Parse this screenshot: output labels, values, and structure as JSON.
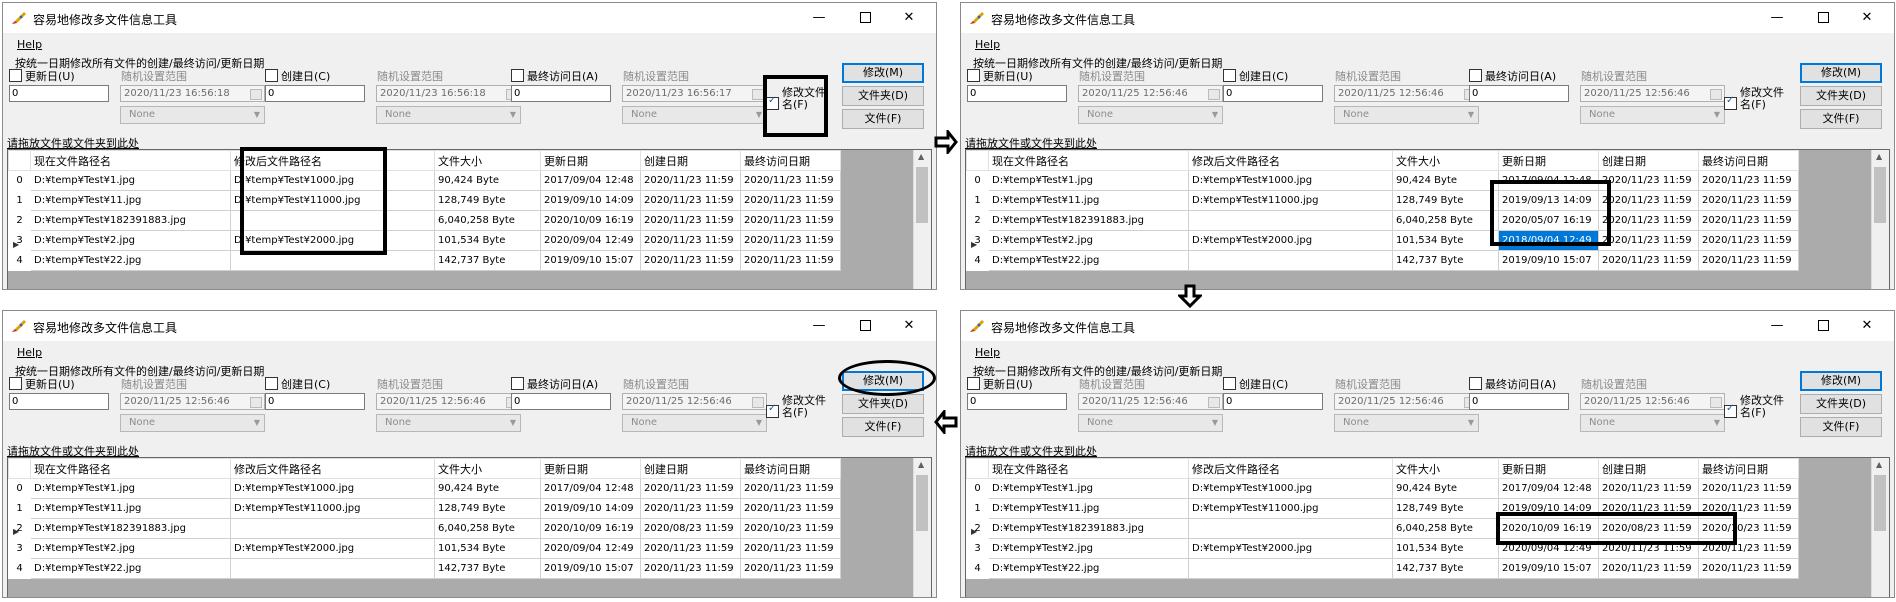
{
  "app": {
    "title": "容易地修改多文件信息工具",
    "menu_help": "Help",
    "instruction": "按统一日期修改所有文件的创建/最终访问/更新日期"
  },
  "controls": {
    "update_label": "更新日(U)",
    "create_label": "创建日(C)",
    "access_label": "最终访问日(A)",
    "random_label": "随机设置范围",
    "none_label": "None",
    "rename_label": "修改文件名(F)",
    "btn_modify": "修改(M)",
    "btn_folder": "文件夹(D)",
    "btn_file": "文件(F)",
    "drop_label": "请拖放文件或文件夹到此处"
  },
  "columns": [
    "现在文件路径名",
    "修改后文件路径名",
    "文件大小",
    "更新日期",
    "创建日期",
    "最终访问日期"
  ],
  "screens": [
    {
      "num_value": "0",
      "dates": [
        "2020/11/23 16:56:18",
        "2020/11/23 16:56:18",
        "2020/11/23 16:56:17"
      ],
      "rename_checked": true,
      "rows": [
        [
          "0",
          "D:¥temp¥Test¥1.jpg",
          "D:¥temp¥Test¥1000.jpg",
          "90,424 Byte",
          "2017/09/04 12:48",
          "2020/11/23 11:59",
          "2020/11/23 11:59"
        ],
        [
          "1",
          "D:¥temp¥Test¥11.jpg",
          "D:¥temp¥Test¥11000.jpg",
          "128,749 Byte",
          "2019/09/10 14:09",
          "2020/11/23 11:59",
          "2020/11/23 11:59"
        ],
        [
          "2",
          "D:¥temp¥Test¥182391883.jpg",
          "",
          "6,040,258 Byte",
          "2020/10/09 16:19",
          "2020/11/23 11:59",
          "2020/11/23 11:59"
        ],
        [
          "3",
          "D:¥temp¥Test¥2.jpg",
          "D:¥temp¥Test¥2000.jpg",
          "101,534 Byte",
          "2020/09/04 12:49",
          "2020/11/23 11:59",
          "2020/11/23 11:59"
        ],
        [
          "4",
          "D:¥temp¥Test¥22.jpg",
          "",
          "142,737 Byte",
          "2019/09/10 15:07",
          "2020/11/23 11:59",
          "2020/11/23 11:59"
        ]
      ]
    },
    {
      "num_value": "0",
      "dates": [
        "2020/11/25 12:56:46",
        "2020/11/25 12:56:46",
        "2020/11/25 12:56:46"
      ],
      "rename_checked": true,
      "rows": [
        [
          "0",
          "D:¥temp¥Test¥1.jpg",
          "D:¥temp¥Test¥1000.jpg",
          "90,424 Byte",
          "2017/09/04 12:48",
          "2020/11/23 11:59",
          "2020/11/23 11:59"
        ],
        [
          "1",
          "D:¥temp¥Test¥11.jpg",
          "D:¥temp¥Test¥11000.jpg",
          "128,749 Byte",
          "2019/09/13 14:09",
          "2020/11/23 11:59",
          "2020/11/23 11:59"
        ],
        [
          "2",
          "D:¥temp¥Test¥182391883.jpg",
          "",
          "6,040,258 Byte",
          "2020/05/07 16:19",
          "2020/11/23 11:59",
          "2020/11/23 11:59"
        ],
        [
          "3",
          "D:¥temp¥Test¥2.jpg",
          "D:¥temp¥Test¥2000.jpg",
          "101,534 Byte",
          "2018/09/04 12:49",
          "2020/11/23 11:59",
          "2020/11/23 11:59"
        ],
        [
          "4",
          "D:¥temp¥Test¥22.jpg",
          "",
          "142,737 Byte",
          "2019/09/10 15:07",
          "2020/11/23 11:59",
          "2020/11/23 11:59"
        ]
      ]
    },
    {
      "num_value": "0",
      "dates": [
        "2020/11/25 12:56:46",
        "2020/11/25 12:56:46",
        "2020/11/25 12:56:46"
      ],
      "rename_checked": true,
      "rows": [
        [
          "0",
          "D:¥temp¥Test¥1.jpg",
          "D:¥temp¥Test¥1000.jpg",
          "90,424 Byte",
          "2017/09/04 12:48",
          "2020/11/23 11:59",
          "2020/11/23 11:59"
        ],
        [
          "1",
          "D:¥temp¥Test¥11.jpg",
          "D:¥temp¥Test¥11000.jpg",
          "128,749 Byte",
          "2019/09/10 14:09",
          "2020/11/23 11:59",
          "2020/11/23 11:59"
        ],
        [
          "2",
          "D:¥temp¥Test¥182391883.jpg",
          "",
          "6,040,258 Byte",
          "2020/10/09 16:19",
          "2020/08/23 11:59",
          "2020/10/23 11:59"
        ],
        [
          "3",
          "D:¥temp¥Test¥2.jpg",
          "D:¥temp¥Test¥2000.jpg",
          "101,534 Byte",
          "2020/09/04 12:49",
          "2020/11/23 11:59",
          "2020/11/23 11:59"
        ],
        [
          "4",
          "D:¥temp¥Test¥22.jpg",
          "",
          "142,737 Byte",
          "2019/09/10 15:07",
          "2020/11/23 11:59",
          "2020/11/23 11:59"
        ]
      ]
    },
    {
      "num_value": "0",
      "dates": [
        "2020/11/25 12:56:46",
        "2020/11/25 12:56:46",
        "2020/11/25 12:56:46"
      ],
      "rename_checked": true,
      "rows": [
        [
          "0",
          "D:¥temp¥Test¥1.jpg",
          "D:¥temp¥Test¥1000.jpg",
          "90,424 Byte",
          "2017/09/04 12:48",
          "2020/11/23 11:59",
          "2020/11/23 11:59"
        ],
        [
          "1",
          "D:¥temp¥Test¥11.jpg",
          "D:¥temp¥Test¥11000.jpg",
          "128,749 Byte",
          "2019/09/10 14:09",
          "2020/11/23 11:59",
          "2020/11/23 11:59"
        ],
        [
          "2",
          "D:¥temp¥Test¥182391883.jpg",
          "",
          "6,040,258 Byte",
          "2020/10/09 16:19",
          "2020/08/23 11:59",
          "2020/10/23 11:59"
        ],
        [
          "3",
          "D:¥temp¥Test¥2.jpg",
          "D:¥temp¥Test¥2000.jpg",
          "101,534 Byte",
          "2020/09/04 12:49",
          "2020/11/23 11:59",
          "2020/11/23 11:59"
        ],
        [
          "4",
          "D:¥temp¥Test¥22.jpg",
          "",
          "142,737 Byte",
          "2019/09/10 15:07",
          "2020/11/23 11:59",
          "2020/11/23 11:59"
        ]
      ]
    }
  ]
}
